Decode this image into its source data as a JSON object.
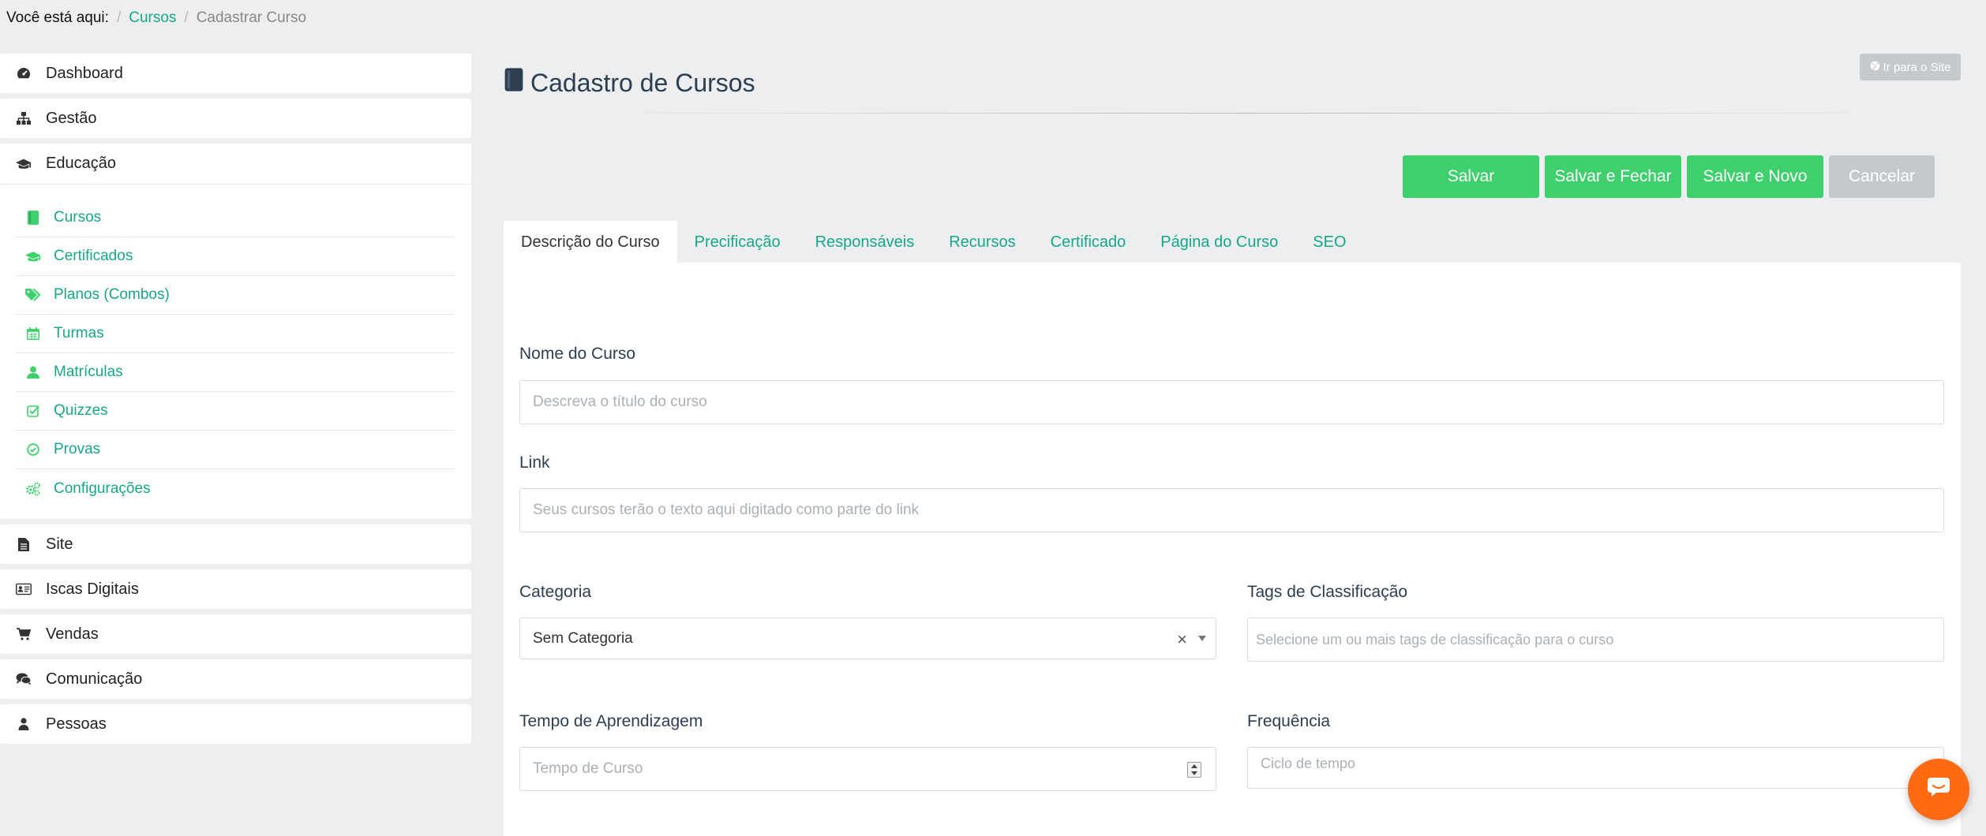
{
  "breadcrumb": {
    "prefix": "Você está aqui:",
    "items": [
      "Cursos",
      "Cadastrar Curso"
    ]
  },
  "sidebar": {
    "items_top": [
      {
        "label": "Dashboard",
        "icon": "dashboard-icon"
      },
      {
        "label": "Gestão",
        "icon": "sitemap-icon"
      }
    ],
    "education": {
      "label": "Educação",
      "icon": "graduation-cap-icon",
      "subitems": [
        {
          "label": "Cursos",
          "icon": "book-icon"
        },
        {
          "label": "Certificados",
          "icon": "graduation-cap-icon"
        },
        {
          "label": "Planos (Combos)",
          "icon": "tags-icon"
        },
        {
          "label": "Turmas",
          "icon": "calendar-icon"
        },
        {
          "label": "Matrículas",
          "icon": "user-icon"
        },
        {
          "label": "Quizzes",
          "icon": "check-square-icon"
        },
        {
          "label": "Provas",
          "icon": "check-circle-icon"
        },
        {
          "label": "Configurações",
          "icon": "cogs-icon"
        }
      ]
    },
    "items_bottom": [
      {
        "label": "Site",
        "icon": "file-icon"
      },
      {
        "label": "Iscas Digitais",
        "icon": "id-card-icon"
      },
      {
        "label": "Vendas",
        "icon": "cart-icon"
      },
      {
        "label": "Comunicação",
        "icon": "comments-icon"
      },
      {
        "label": "Pessoas",
        "icon": "person-icon"
      }
    ]
  },
  "header": {
    "title": "Cadastro de Cursos",
    "site_link": "Ir para o Site"
  },
  "actions": {
    "save": "Salvar",
    "save_close": "Salvar e Fechar",
    "save_new": "Salvar e Novo",
    "cancel": "Cancelar"
  },
  "tabs": [
    "Descrição do Curso",
    "Precificação",
    "Responsáveis",
    "Recursos",
    "Certificado",
    "Página do Curso",
    "SEO"
  ],
  "form": {
    "course_name": {
      "label": "Nome do Curso",
      "placeholder": "Descreva o título do curso"
    },
    "link": {
      "label": "Link",
      "placeholder": "Seus cursos terão o texto aqui digitado como parte do link"
    },
    "category": {
      "label": "Categoria",
      "value": "Sem Categoria"
    },
    "tags": {
      "label": "Tags de Classificação",
      "placeholder": "Selecione um ou mais tags de classificação para o curso"
    },
    "learning_time": {
      "label": "Tempo de Aprendizagem",
      "placeholder": "Tempo de Curso"
    },
    "frequency": {
      "label": "Frequência",
      "placeholder": "Ciclo de tempo"
    }
  },
  "colors": {
    "accent": "#18a689",
    "button_green": "#3fd06d",
    "button_grey": "#c6c9cc",
    "chat": "#ff6a13"
  }
}
